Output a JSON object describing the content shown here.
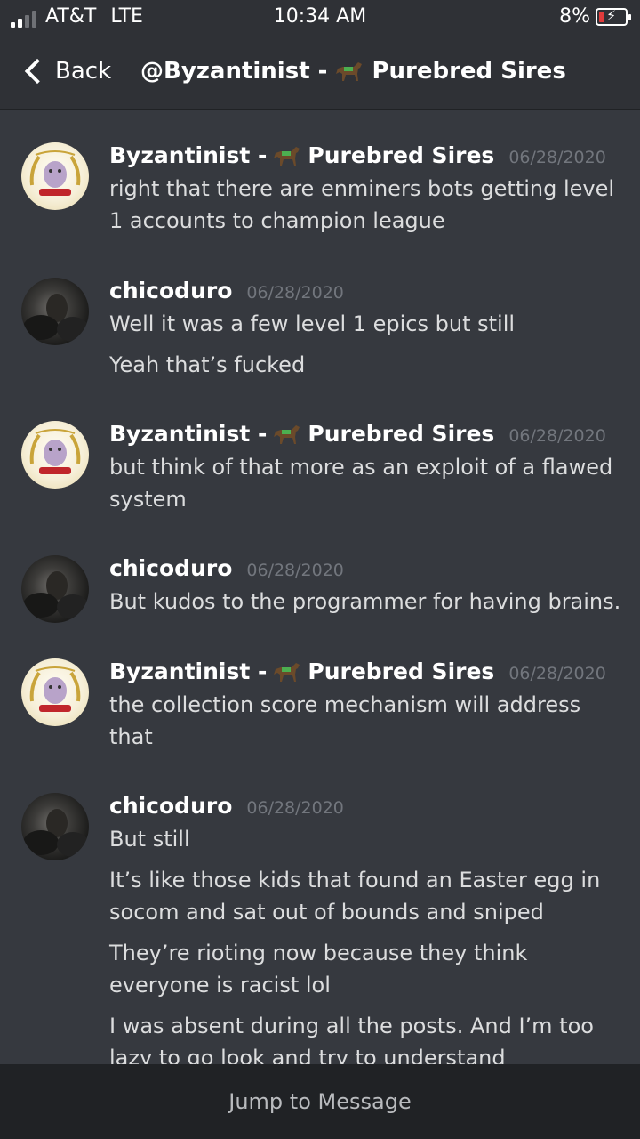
{
  "status_bar": {
    "carrier": "AT&T",
    "network": "LTE",
    "time": "10:34 AM",
    "battery_percent": "8%",
    "battery_level": 0.08
  },
  "nav": {
    "back_label": "Back",
    "title_prefix": "@Byzantinist -",
    "title_suffix": "Purebred Sires"
  },
  "messages": [
    {
      "author_prefix": "Byzantinist -",
      "author_suffix": "Purebred Sires",
      "timestamp": "06/28/2020",
      "lines": [
        "right that there are enminers bots getting level 1 accounts to champion league"
      ]
    },
    {
      "author_prefix": "chicoduro",
      "author_suffix": "",
      "timestamp": "06/28/2020",
      "lines": [
        "Well it was a few level 1 epics but still",
        "Yeah that’s fucked"
      ]
    },
    {
      "author_prefix": "Byzantinist -",
      "author_suffix": "Purebred Sires",
      "timestamp": "06/28/2020",
      "lines": [
        "but think of that more as an exploit of a flawed system"
      ]
    },
    {
      "author_prefix": "chicoduro",
      "author_suffix": "",
      "timestamp": "06/28/2020",
      "lines": [
        "But kudos to the programmer for having brains."
      ]
    },
    {
      "author_prefix": "Byzantinist -",
      "author_suffix": "Purebred Sires",
      "timestamp": "06/28/2020",
      "lines": [
        "the collection score mechanism will address that"
      ]
    },
    {
      "author_prefix": "chicoduro",
      "author_suffix": "",
      "timestamp": "06/28/2020",
      "lines": [
        "But still",
        "It’s like those kids that found an Easter egg in socom and sat out of bounds and sniped",
        "They’re rioting now because they think everyone is racist lol",
        "I was absent during all the posts.  And I’m too lazy to go look and try to understand"
      ]
    }
  ],
  "jump_bar": {
    "label": "Jump to Message"
  },
  "colors": {
    "background": "#36393f",
    "nav_background": "#2f3136",
    "bottom_bar": "#202225",
    "timestamp": "#72767d",
    "text": "#dcddde"
  }
}
